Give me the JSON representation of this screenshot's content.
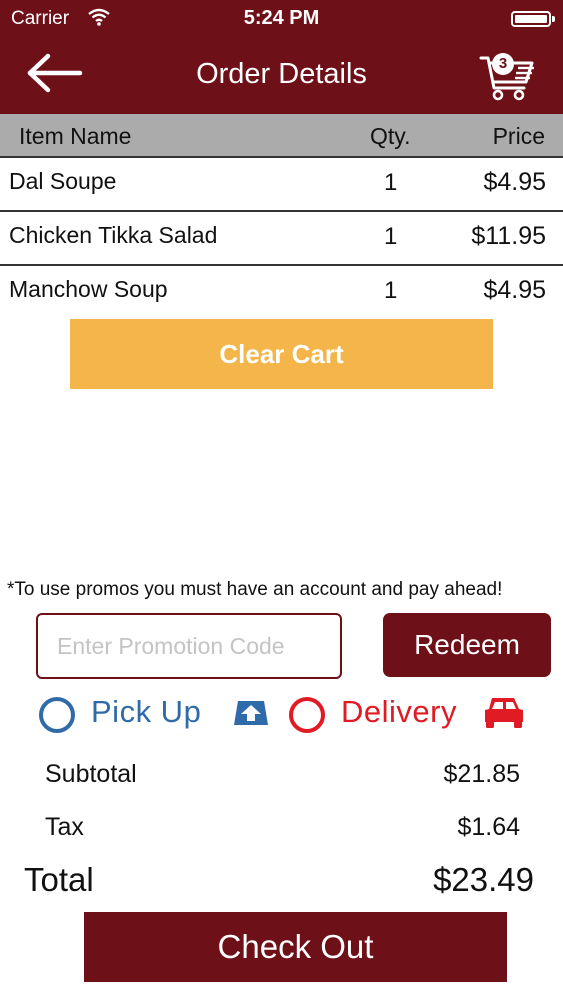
{
  "status_bar": {
    "carrier": "Carrier",
    "time": "5:24 PM"
  },
  "nav": {
    "title": "Order Details",
    "back_icon": "arrow-left-icon",
    "cart_icon": "cart-icon",
    "cart_count": "3"
  },
  "table": {
    "headers": {
      "name": "Item Name",
      "qty": "Qty.",
      "price": "Price"
    },
    "rows": [
      {
        "name": "Dal Soupe",
        "qty": "1",
        "price": "$4.95"
      },
      {
        "name": "Chicken Tikka Salad",
        "qty": "1",
        "price": "$11.95"
      },
      {
        "name": "Manchow Soup",
        "qty": "1",
        "price": "$4.95"
      }
    ]
  },
  "clear_cart_label": "Clear Cart",
  "promo": {
    "note": "*To use promos you must have an account and pay ahead!",
    "placeholder": "Enter Promotion Code",
    "value": "",
    "redeem_label": "Redeem"
  },
  "order_type": {
    "pickup_label": "Pick Up",
    "delivery_label": "Delivery",
    "pickup_color": "#2f6ba8",
    "delivery_color": "#e01b24"
  },
  "summary": {
    "subtotal_label": "Subtotal",
    "subtotal_value": "$21.85",
    "tax_label": "Tax",
    "tax_value": "$1.64",
    "total_label": "Total",
    "total_value": "$23.49"
  },
  "checkout_label": "Check Out",
  "colors": {
    "brand": "#6e1018",
    "accent": "#f4b64a",
    "header_gray": "#ababab"
  }
}
